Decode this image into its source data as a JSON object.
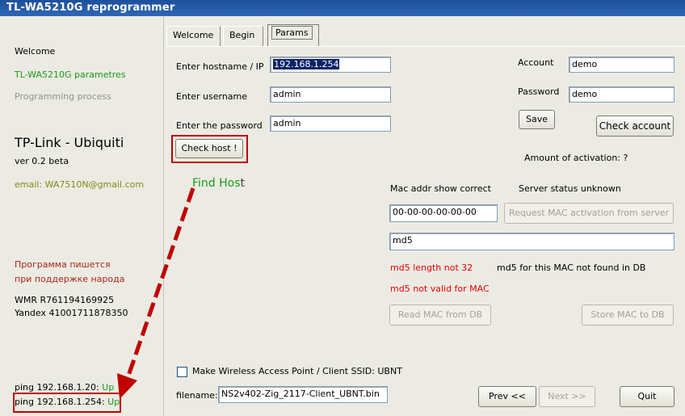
{
  "window": {
    "title": "TL-WA5210G reprogrammer"
  },
  "sidebar": {
    "items": [
      {
        "label": "Welcome"
      },
      {
        "label": "TL-WA5210G parametres"
      },
      {
        "label": "Programming process"
      }
    ],
    "app_name": "TP-Link - Ubiquiti",
    "version": "ver 0.2 beta",
    "email": "email: WA7510N@gmail.com",
    "support_line1": "Программа пишется",
    "support_line2": "при поддержке народа",
    "wmr": "WMR R761194169925",
    "yandex": "Yandex 41001711878350",
    "ping1": {
      "label": "ping 192.168.1.20:",
      "status": "Up"
    },
    "ping2": {
      "label": "ping 192.168.1.254:",
      "status": "Up"
    }
  },
  "tabs": [
    {
      "label": "Welcome"
    },
    {
      "label": "Begin"
    },
    {
      "label": "Params"
    }
  ],
  "form": {
    "hostname_label": "Enter hostname / IP",
    "hostname_value": "192.168.1.254",
    "username_label": "Enter username",
    "username_value": "admin",
    "password_label": "Enter the password",
    "password_value": "admin",
    "check_host_label": "Check host !",
    "account_label": "Account",
    "account_value": "demo",
    "acc_password_label": "Password",
    "acc_password_value": "demo",
    "save_label": "Save",
    "check_account_label": "Check account",
    "activation_text": "Amount of activation: ?",
    "annotation_find_host": {
      "prefix": "Find Hos",
      "suffix": "t"
    },
    "mac_status": "Mac addr show correct",
    "server_status": "Server status unknown",
    "mac_value": "00-00-00-00-00-00",
    "request_mac_label": "Request MAC activation from server",
    "md5_value": "md5",
    "md5_length_msg": "md5 length not 32",
    "md5_db_msg": "md5 for this MAC not found in DB",
    "md5_invalid_msg": "md5 not valid for MAC",
    "read_mac_label": "Read MAC from DB",
    "store_mac_label": "Store MAC to DB",
    "ssid_checkbox_label": "Make Wireless Access Point / Client SSID: UBNT",
    "filename_label": "filename:",
    "filename_value": "NS2v402-Zig_2117-Client_UBNT.bin",
    "prev_label": "Prev <<",
    "next_label": "Next >>",
    "quit_label": "Quit"
  },
  "colors": {
    "title_bar": "#1e4f9a",
    "annotation_red": "#c00000",
    "status_green": "#1a9a1a",
    "error_red": "#e00000"
  }
}
